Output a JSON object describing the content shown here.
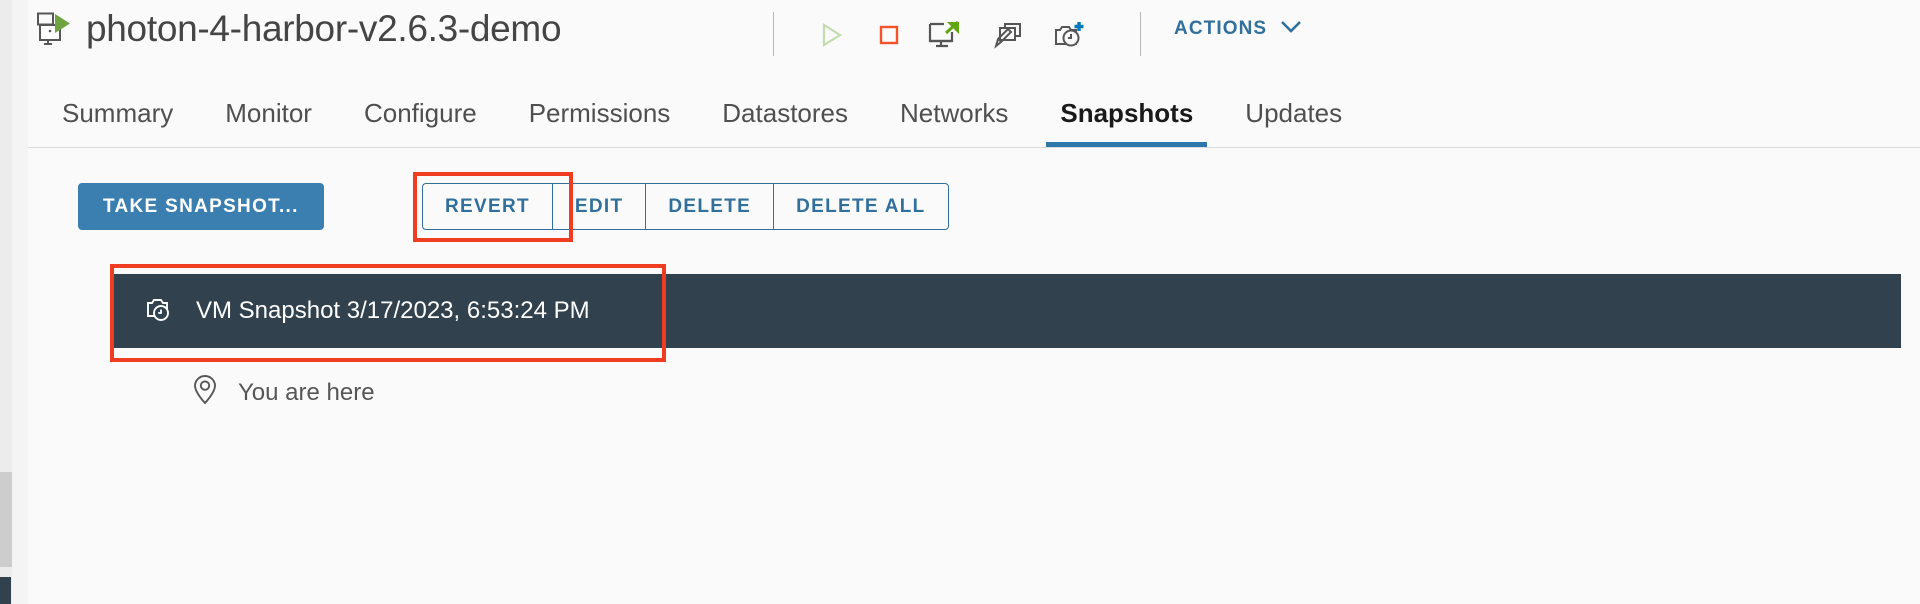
{
  "window": {
    "background_color": "#fafafa"
  },
  "header": {
    "vm_icon": "virtual-machine-icon",
    "title": "photon-4-harbor-v2.6.3-demo",
    "toolbar_icons": [
      {
        "name": "power-on-icon",
        "title": "Power On",
        "state": "disabled",
        "color": "#c3dcae"
      },
      {
        "name": "power-off-icon",
        "title": "Power Off",
        "state": "enabled",
        "color": "#f2542a"
      },
      {
        "name": "launch-web-console-icon",
        "title": "Launch Web Console",
        "state": "enabled",
        "color": "#61a60e"
      },
      {
        "name": "edit-vm-icon",
        "title": "Edit Virtual Machine",
        "state": "enabled",
        "color": "#565656"
      },
      {
        "name": "take-snapshot-icon",
        "title": "Take Snapshot",
        "state": "enabled",
        "color": "#0079b8"
      }
    ],
    "actions": {
      "label": "ACTIONS",
      "chevron": "chevron-down-icon",
      "color": "#31709c"
    }
  },
  "tabs": {
    "active": "Snapshots",
    "accent_color": "#2e77ab",
    "items": [
      {
        "label": "Summary"
      },
      {
        "label": "Monitor"
      },
      {
        "label": "Configure"
      },
      {
        "label": "Permissions"
      },
      {
        "label": "Datastores"
      },
      {
        "label": "Networks"
      },
      {
        "label": "Snapshots"
      },
      {
        "label": "Updates"
      }
    ]
  },
  "toolbar": {
    "take_snapshot_label": "TAKE SNAPSHOT...",
    "take_snapshot_color": "#3b7fb0",
    "group": [
      {
        "label": "REVERT"
      },
      {
        "label": "EDIT"
      },
      {
        "label": "DELETE"
      },
      {
        "label": "DELETE ALL"
      }
    ],
    "group_color": "#31709c"
  },
  "snapshot_tree": {
    "selected_row": {
      "icon": "snapshot-clock-icon",
      "label": "VM Snapshot 3/17/2023, 6:53:24 PM",
      "selected_background": "#31414e",
      "text_color": "#ffffff"
    },
    "current_position": {
      "icon": "map-pin-icon",
      "label": "You are here"
    }
  },
  "annotations": {
    "color": "#f03c20",
    "boxes": [
      {
        "name": "revert-button-highlight",
        "target": "REVERT"
      },
      {
        "name": "snapshot-row-highlight",
        "target": "VM Snapshot 3/17/2023, 6:53:24 PM"
      }
    ]
  },
  "scrollbar": {
    "track_color": "#ececec",
    "thumb_color": "#cdcdcd"
  }
}
